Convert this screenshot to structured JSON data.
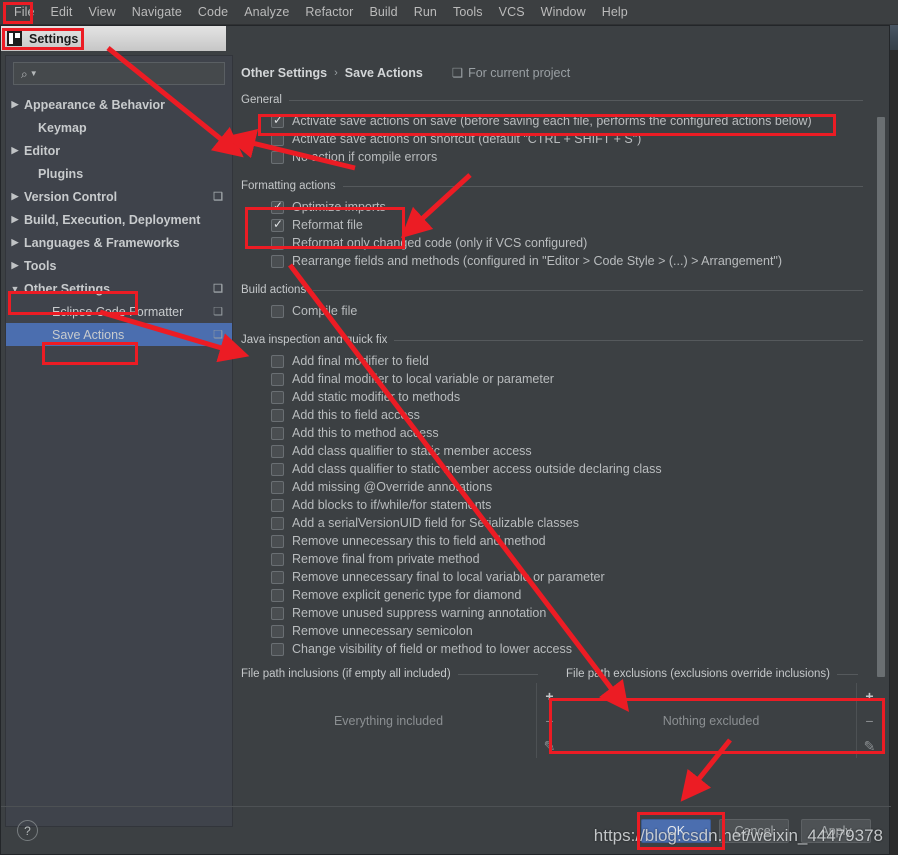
{
  "menubar": {
    "items": [
      "File",
      "Edit",
      "View",
      "Navigate",
      "Code",
      "Analyze",
      "Refactor",
      "Build",
      "Run",
      "Tools",
      "VCS",
      "Window",
      "Help"
    ]
  },
  "window": {
    "title": "Settings",
    "close_label": "✕",
    "logo_name": "intellij-idea-logo"
  },
  "sidebar": {
    "search": {
      "placeholder": "",
      "value": ""
    },
    "items": [
      {
        "label": "Appearance & Behavior",
        "arrow": "▶",
        "bold": true,
        "indent": 0,
        "selected": false,
        "copy": false
      },
      {
        "label": "Keymap",
        "arrow": "",
        "bold": true,
        "indent": 1,
        "selected": false,
        "copy": false
      },
      {
        "label": "Editor",
        "arrow": "▶",
        "bold": true,
        "indent": 0,
        "selected": false,
        "copy": false
      },
      {
        "label": "Plugins",
        "arrow": "",
        "bold": true,
        "indent": 1,
        "selected": false,
        "copy": false
      },
      {
        "label": "Version Control",
        "arrow": "▶",
        "bold": true,
        "indent": 0,
        "selected": false,
        "copy": true
      },
      {
        "label": "Build, Execution, Deployment",
        "arrow": "▶",
        "bold": true,
        "indent": 0,
        "selected": false,
        "copy": false
      },
      {
        "label": "Languages & Frameworks",
        "arrow": "▶",
        "bold": true,
        "indent": 0,
        "selected": false,
        "copy": false
      },
      {
        "label": "Tools",
        "arrow": "▶",
        "bold": true,
        "indent": 0,
        "selected": false,
        "copy": false
      },
      {
        "label": "Other Settings",
        "arrow": "▼",
        "bold": true,
        "indent": 0,
        "selected": false,
        "copy": true
      },
      {
        "label": "Eclipse Code Formatter",
        "arrow": "",
        "bold": false,
        "indent": 2,
        "selected": false,
        "copy": true
      },
      {
        "label": "Save Actions",
        "arrow": "",
        "bold": false,
        "indent": 2,
        "selected": true,
        "copy": true
      }
    ]
  },
  "breadcrumb": {
    "root": "Other Settings",
    "separator": "›",
    "leaf": "Save Actions",
    "scope": "For current project"
  },
  "sections": {
    "general": {
      "title": "General",
      "checkboxes": [
        {
          "label": "Activate save actions on save (before saving each file, performs the configured actions below)",
          "checked": true
        },
        {
          "label": "Activate save actions on shortcut (default \"CTRL + SHIFT + S\")",
          "checked": false
        },
        {
          "label": "No action if compile errors",
          "checked": false
        }
      ]
    },
    "formatting": {
      "title": "Formatting actions",
      "checkboxes": [
        {
          "label": "Optimize imports",
          "checked": true
        },
        {
          "label": "Reformat file",
          "checked": true
        },
        {
          "label": "Reformat only changed code (only if VCS configured)",
          "checked": false
        },
        {
          "label": "Rearrange fields and methods (configured in \"Editor > Code Style > (...) > Arrangement\")",
          "checked": false
        }
      ]
    },
    "build": {
      "title": "Build actions",
      "checkboxes": [
        {
          "label": "Compile file",
          "checked": false
        }
      ]
    },
    "java": {
      "title": "Java inspection and quick fix",
      "checkboxes": [
        {
          "label": "Add final modifier to field",
          "checked": false
        },
        {
          "label": "Add final modifier to local variable or parameter",
          "checked": false
        },
        {
          "label": "Add static modifier to methods",
          "checked": false
        },
        {
          "label": "Add this to field access",
          "checked": false
        },
        {
          "label": "Add this to method access",
          "checked": false
        },
        {
          "label": "Add class qualifier to static member access",
          "checked": false
        },
        {
          "label": "Add class qualifier to static member access outside declaring class",
          "checked": false
        },
        {
          "label": "Add missing @Override annotations",
          "checked": false
        },
        {
          "label": "Add blocks to if/while/for statements",
          "checked": false
        },
        {
          "label": "Add a serialVersionUID field for Serializable classes",
          "checked": false
        },
        {
          "label": "Remove unnecessary this to field and method",
          "checked": false
        },
        {
          "label": "Remove final from private method",
          "checked": false
        },
        {
          "label": "Remove unnecessary final to local variable or parameter",
          "checked": false
        },
        {
          "label": "Remove explicit generic type for diamond",
          "checked": false
        },
        {
          "label": "Remove unused suppress warning annotation",
          "checked": false
        },
        {
          "label": "Remove unnecessary semicolon",
          "checked": false
        },
        {
          "label": "Change visibility of field or method to lower access",
          "checked": false
        }
      ]
    }
  },
  "paths": {
    "inclusions": {
      "title": "File path inclusions (if empty all included)",
      "empty_text": "Everything included"
    },
    "exclusions": {
      "title": "File path exclusions (exclusions override inclusions)",
      "empty_text": "Nothing excluded"
    },
    "tools": {
      "add": "+",
      "remove": "−",
      "edit": "✎"
    }
  },
  "buttons": {
    "help": "?",
    "ok": "OK",
    "cancel": "Cancel",
    "apply": "Apply"
  },
  "watermark": "https://blog.csdn.net/weixin_44479378",
  "annotation_color": "#ec1c24"
}
